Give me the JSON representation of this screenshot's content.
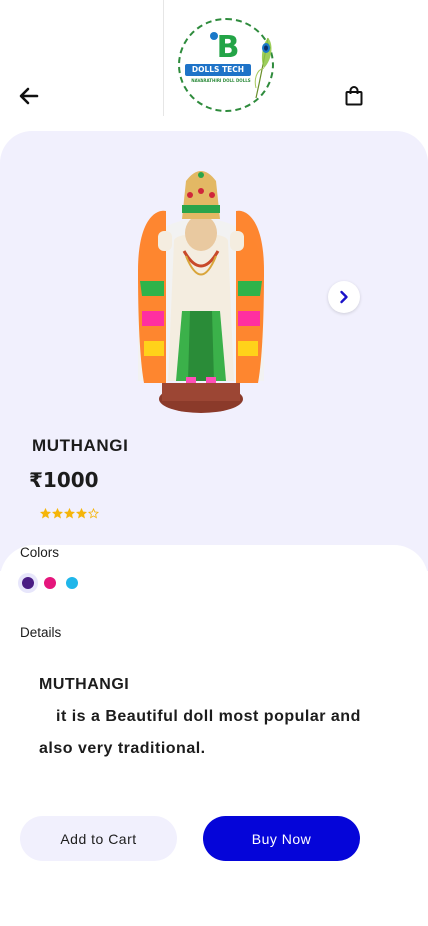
{
  "header": {
    "logo": {
      "brand": "DOLLS TECH",
      "tagline": "NAVARATHIRI DOLL DOLLS",
      "letter": "B"
    },
    "back_icon": "arrow-left-icon",
    "cart_icon": "shopping-bag-icon"
  },
  "product": {
    "name": "MUTHANGI",
    "price": "₹1000",
    "rating": {
      "value": 4,
      "max": 5
    },
    "image": "deity-doll-image",
    "next_icon": "chevron-right-icon"
  },
  "colors": {
    "label": "Colors",
    "options": [
      "#4a1d84",
      "#e5167c",
      "#1fb6ea"
    ],
    "selected_index": 0
  },
  "details": {
    "label": "Details",
    "title": "MUTHANGI",
    "description": "it is a Beautiful doll most popular and also very traditional."
  },
  "actions": {
    "add_to_cart": "Add to Cart",
    "buy_now": "Buy Now",
    "buy_color": "#0505d9"
  },
  "theme": {
    "panel_bg": "#f1f0fd",
    "star_color": "#f5b50a"
  }
}
